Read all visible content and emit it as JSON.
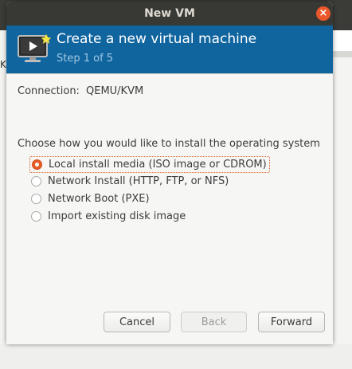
{
  "background": {
    "left_text": "KV"
  },
  "window": {
    "title": "New VM",
    "close_icon": "close-icon"
  },
  "banner": {
    "title": "Create a new virtual machine",
    "step": "Step 1 of 5",
    "icon": "new-vm-monitor-icon",
    "color": "#10659f"
  },
  "connection": {
    "label": "Connection:",
    "value": "QEMU/KVM"
  },
  "install": {
    "prompt": "Choose how you would like to install the operating system",
    "options": [
      {
        "label": "Local install media (ISO image or CDROM)",
        "selected": true
      },
      {
        "label": "Network Install (HTTP, FTP, or NFS)",
        "selected": false
      },
      {
        "label": "Network Boot (PXE)",
        "selected": false
      },
      {
        "label": "Import existing disk image",
        "selected": false
      }
    ]
  },
  "buttons": {
    "cancel": "Cancel",
    "back": "Back",
    "forward": "Forward"
  },
  "accent": "#e45d25"
}
